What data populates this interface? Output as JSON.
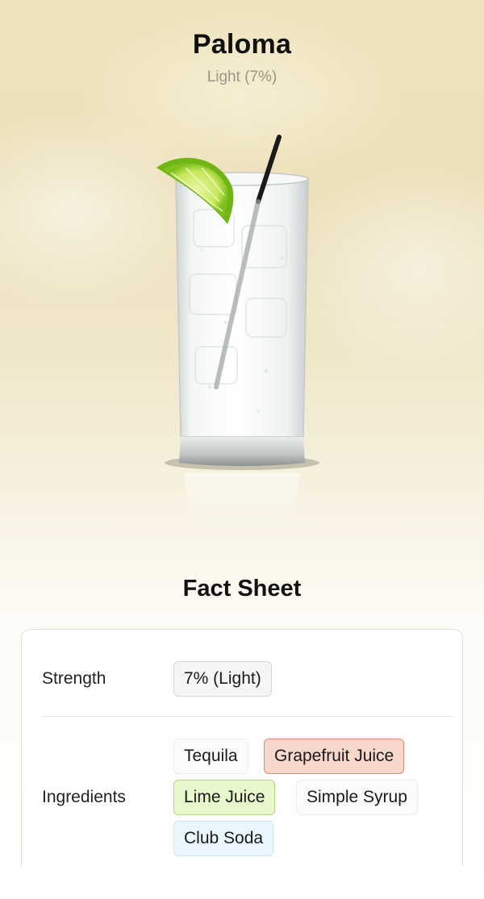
{
  "header": {
    "title": "Paloma",
    "subtitle": "Light (7%)"
  },
  "image": {
    "icon": "highball-glass-with-lime-and-straw"
  },
  "fact_sheet": {
    "title": "Fact Sheet",
    "strength": {
      "label": "Strength",
      "value": "7% (Light)"
    },
    "ingredients": {
      "label": "Ingredients",
      "items": [
        {
          "name": "Tequila",
          "color": "#fbfbfb"
        },
        {
          "name": "Grapefruit Juice",
          "color": "#f8d8cc"
        },
        {
          "name": "Lime Juice",
          "color": "#e8f7cc"
        },
        {
          "name": "Simple Syrup",
          "color": "#fbfbfb"
        },
        {
          "name": "Club Soda",
          "color": "#eaf6fd"
        }
      ]
    }
  }
}
